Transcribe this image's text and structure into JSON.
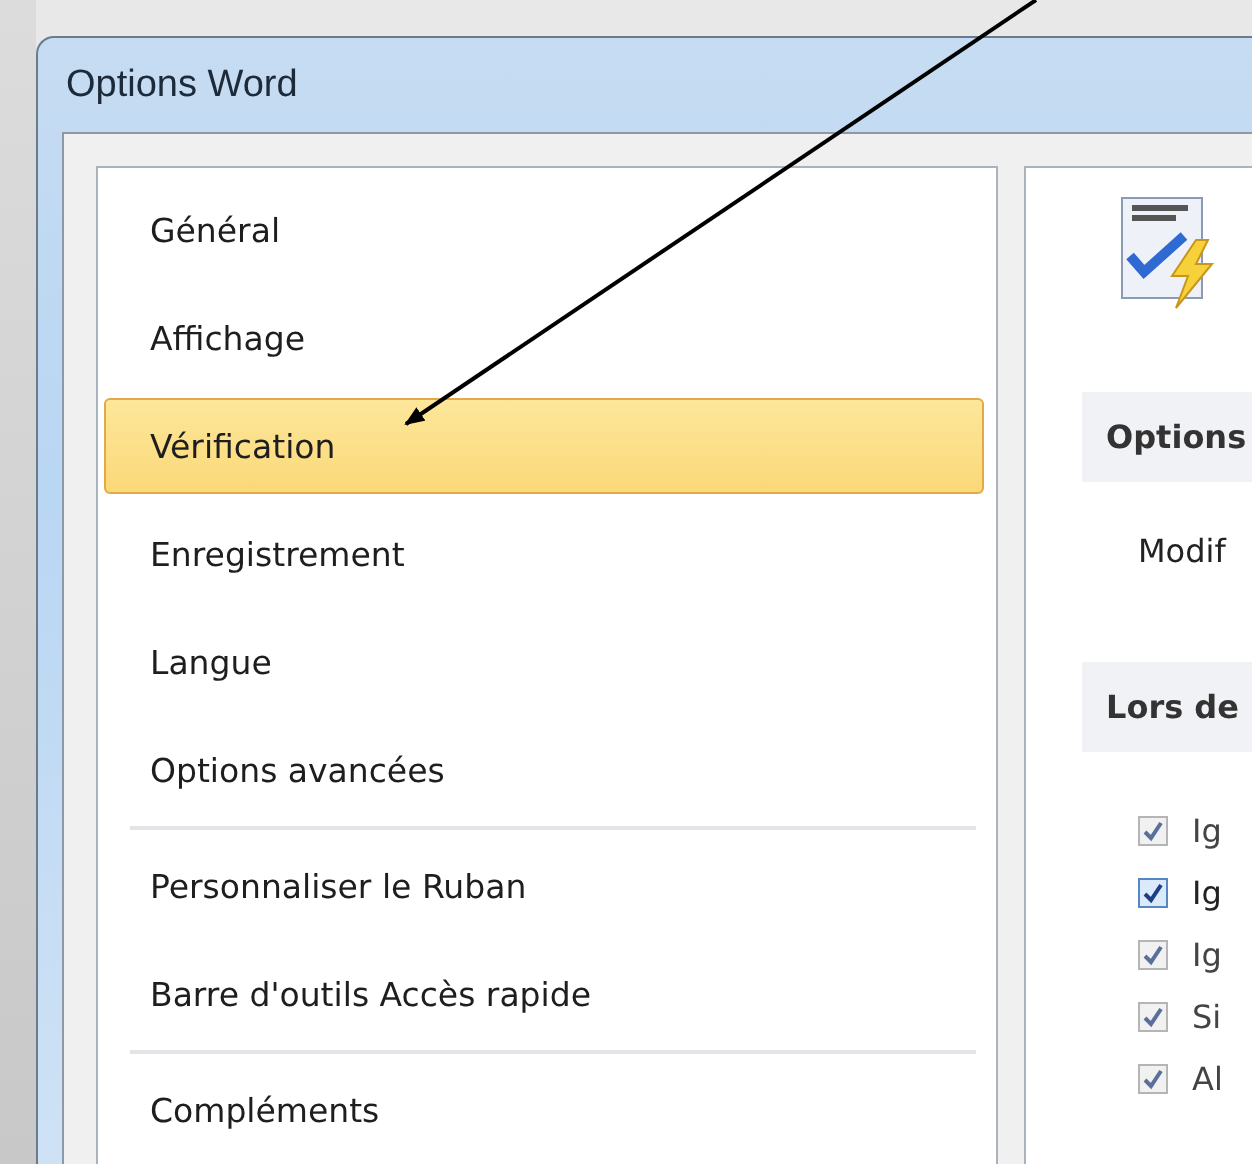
{
  "window": {
    "title": "Options Word"
  },
  "sidebar": {
    "groups": [
      [
        {
          "label": "Général",
          "selected": false
        },
        {
          "label": "Affichage",
          "selected": false
        },
        {
          "label": "Vérification",
          "selected": true
        },
        {
          "label": "Enregistrement",
          "selected": false
        },
        {
          "label": "Langue",
          "selected": false
        },
        {
          "label": "Options avancées",
          "selected": false
        }
      ],
      [
        {
          "label": "Personnaliser le Ruban",
          "selected": false
        },
        {
          "label": "Barre d'outils Accès rapide",
          "selected": false
        }
      ],
      [
        {
          "label": "Compléments",
          "selected": false
        }
      ]
    ]
  },
  "content": {
    "sections": [
      {
        "heading": "Options",
        "rows": [
          {
            "kind": "text",
            "text": "Modif"
          }
        ]
      },
      {
        "heading": "Lors de",
        "rows": [
          {
            "kind": "checkbox",
            "text": "Ig",
            "checked": true,
            "disabled": true
          },
          {
            "kind": "checkbox",
            "text": "Ig",
            "checked": true,
            "disabled": false
          },
          {
            "kind": "checkbox",
            "text": "Ig",
            "checked": true,
            "disabled": true
          },
          {
            "kind": "checkbox",
            "text": "Si",
            "checked": true,
            "disabled": true
          },
          {
            "kind": "checkbox",
            "text": "Al",
            "checked": true,
            "disabled": true
          }
        ]
      }
    ]
  }
}
